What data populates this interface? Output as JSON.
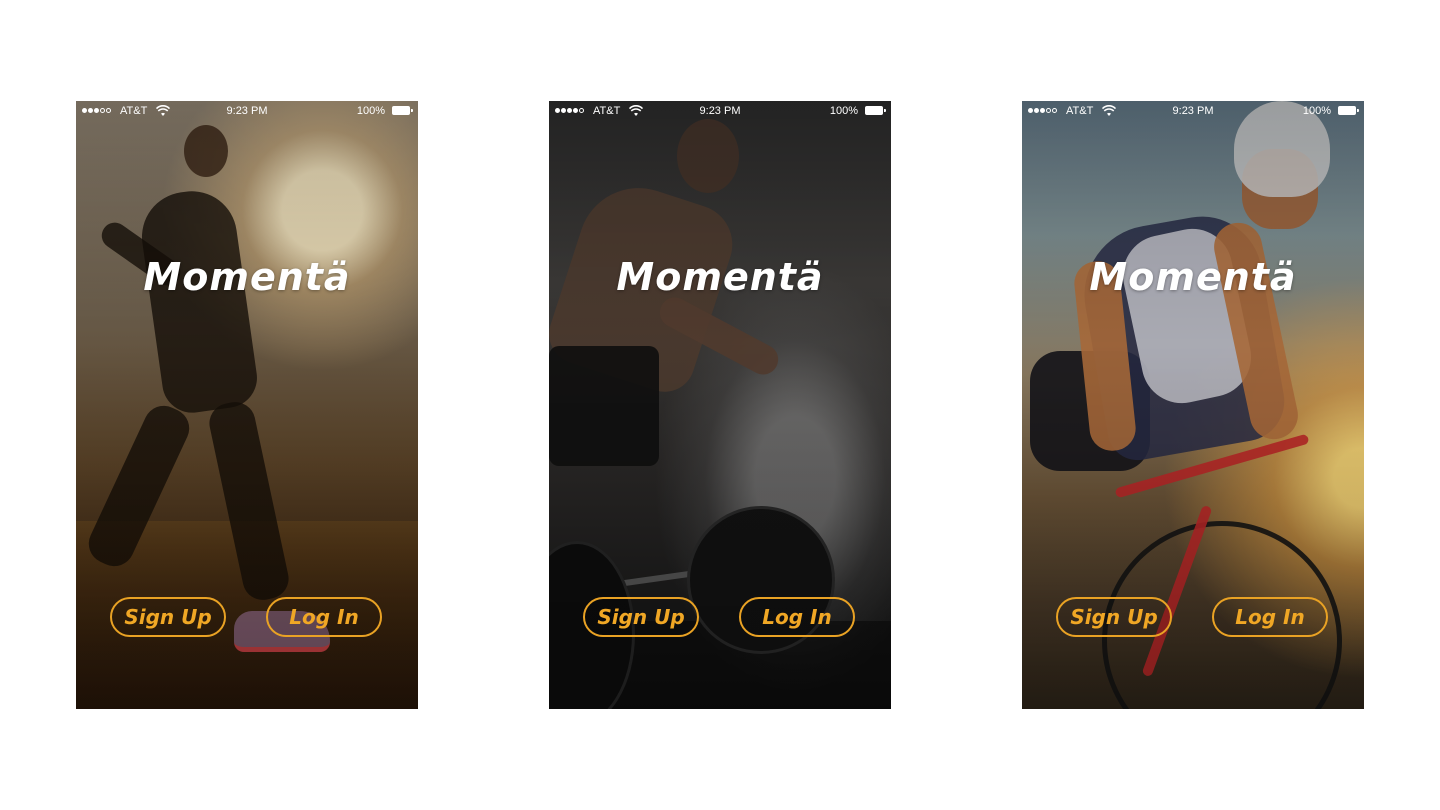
{
  "status_bar": {
    "carrier": "AT&T",
    "time": "9:23 PM",
    "battery": "100%",
    "signal_icon": "signal-dots-icon",
    "wifi_icon": "wifi-icon",
    "battery_icon": "battery-icon"
  },
  "brand": {
    "logo_text": "Momentä",
    "accent_color": "#e9a224"
  },
  "screens": [
    {
      "background": "runner-at-sunset",
      "signup_label": "Sign Up",
      "login_label": "Log In"
    },
    {
      "background": "gym-deadlift-chalk",
      "signup_label": "Sign Up",
      "login_label": "Log In"
    },
    {
      "background": "cyclist-at-sunset",
      "signup_label": "Sign Up",
      "login_label": "Log In"
    }
  ]
}
